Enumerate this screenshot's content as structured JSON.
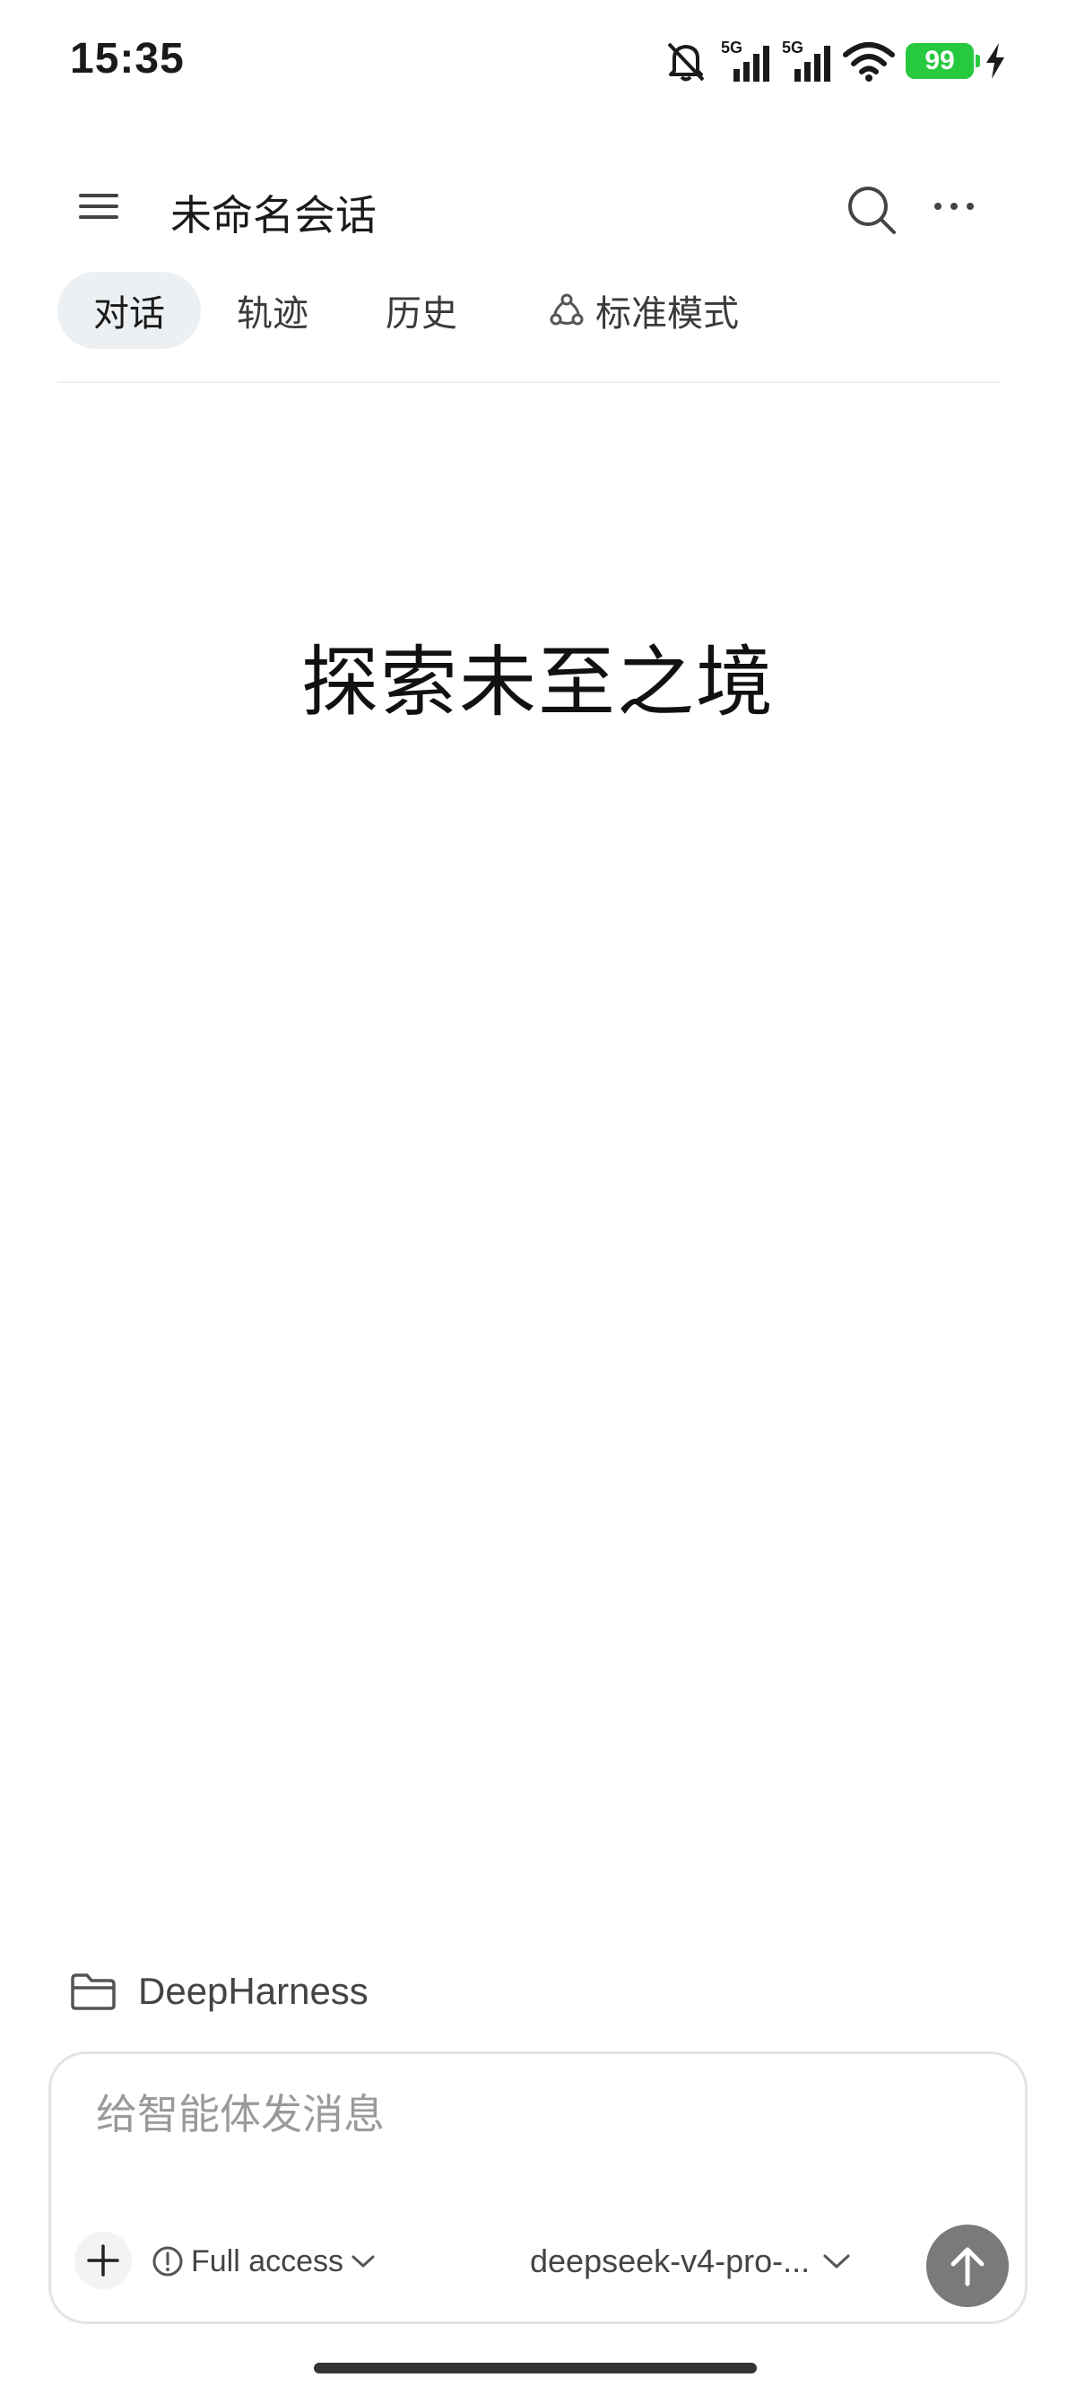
{
  "status_bar": {
    "time": "15:35",
    "network_1": "5G",
    "network_2": "5G",
    "battery_level": "99",
    "icons": [
      "mute-icon",
      "signal-icon",
      "signal-icon",
      "wifi-icon",
      "battery-icon",
      "charging-icon"
    ]
  },
  "header": {
    "title": "未命名会话",
    "menu_icon": "hamburger-menu-icon",
    "search_icon": "search-icon",
    "more_icon": "more-icon"
  },
  "tabs": [
    {
      "label": "对话",
      "active": true
    },
    {
      "label": "轨迹",
      "active": false
    },
    {
      "label": "历史",
      "active": false
    }
  ],
  "mode": {
    "label": "标准模式",
    "icon": "mode-icon"
  },
  "hero": {
    "title": "探索未至之境"
  },
  "workspace": {
    "name": "DeepHarness",
    "icon": "folder-icon"
  },
  "composer": {
    "placeholder": "给智能体发消息",
    "value": "",
    "access_label": "Full access",
    "model_label": "deepseek-v4-pro-...",
    "send_icon": "arrow-up-icon",
    "attach_icon": "plus-icon"
  },
  "colors": {
    "active_tab_bg": "#edf0f3",
    "send_button_bg": "#7a7a7a",
    "battery_green": "#27c93f",
    "border": "#e4e4e4"
  }
}
